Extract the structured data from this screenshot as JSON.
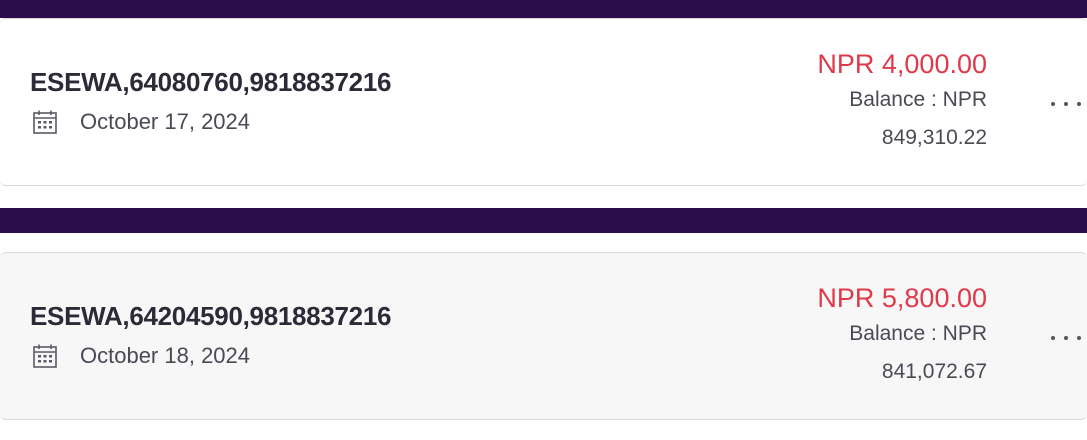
{
  "colors": {
    "band": "#2a0d4a",
    "amount": "#e03a4a",
    "text_primary": "#2b2b38",
    "text_secondary": "#4a4a55"
  },
  "transactions": [
    {
      "reference": "ESEWA,64080760,9818837216",
      "date": "October 17, 2024",
      "date_icon": "calendar-icon",
      "amount": "NPR 4,000.00",
      "balance_label": "Balance : NPR",
      "balance_value": "849,310.22",
      "menu_icon": "more-options-icon"
    },
    {
      "reference": "ESEWA,64204590,9818837216",
      "date": "October 18, 2024",
      "date_icon": "calendar-icon",
      "amount": "NPR 5,800.00",
      "balance_label": "Balance : NPR",
      "balance_value": "841,072.67",
      "menu_icon": "more-options-icon"
    }
  ]
}
